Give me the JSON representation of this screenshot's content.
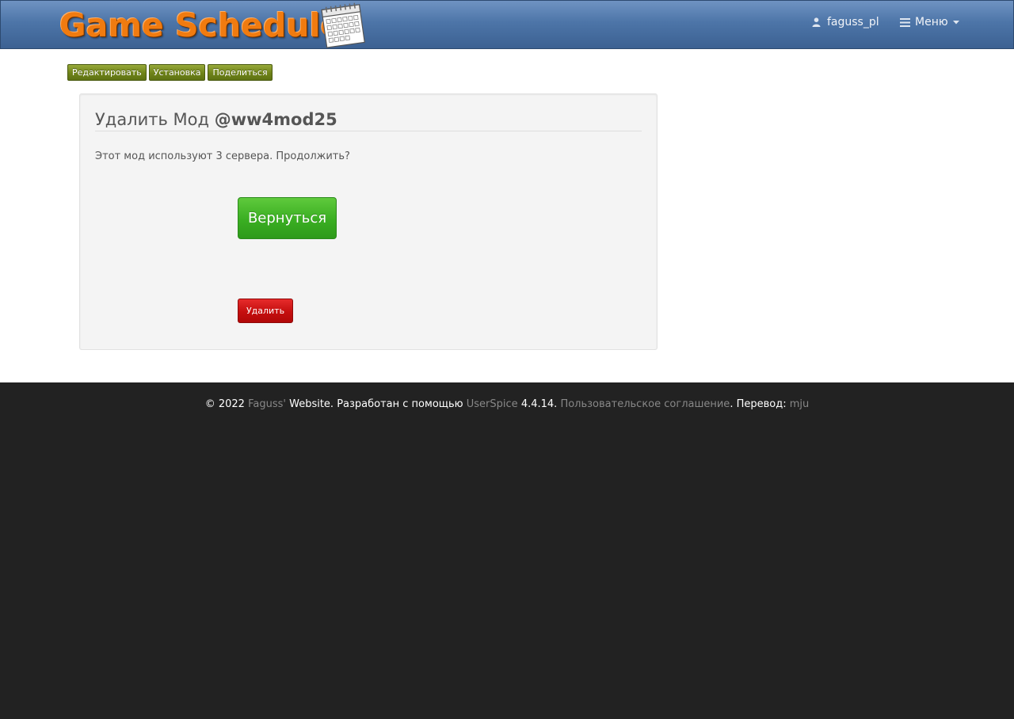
{
  "header": {
    "logo_text": "Game Schedule",
    "user_name": "faguss_pl",
    "menu_label": "Меню",
    "icons": [
      "user-icon",
      "bars-icon",
      "caret-down-icon",
      "calendar-icon"
    ]
  },
  "toolbar": {
    "edit_label": "Редактировать",
    "install_label": "Установка",
    "share_label": "Поделиться"
  },
  "panel": {
    "title_prefix": "Удалить Мод",
    "mod_name": "@ww4mod25",
    "message": "Этот мод используют 3 сервера. Продолжить?",
    "back_label": "Вернуться",
    "delete_label": "Удалить"
  },
  "footer": {
    "copyright": "© 2022",
    "site_link": "Faguss'",
    "site_suffix": "Website. Разработан с помощью",
    "framework_link": "UserSpice",
    "version": "4.4.14.",
    "terms_link": "Пользовательское соглашение",
    "translation_label": ". Перевод:",
    "translator_link": "mju"
  },
  "colors": {
    "navbar": "#4d75a8",
    "logo_orange": "#f07b10",
    "toolbar_green": "#6f8319",
    "back_green": "#3aae22",
    "delete_red": "#c50f0f",
    "footer_bg": "#222222"
  }
}
